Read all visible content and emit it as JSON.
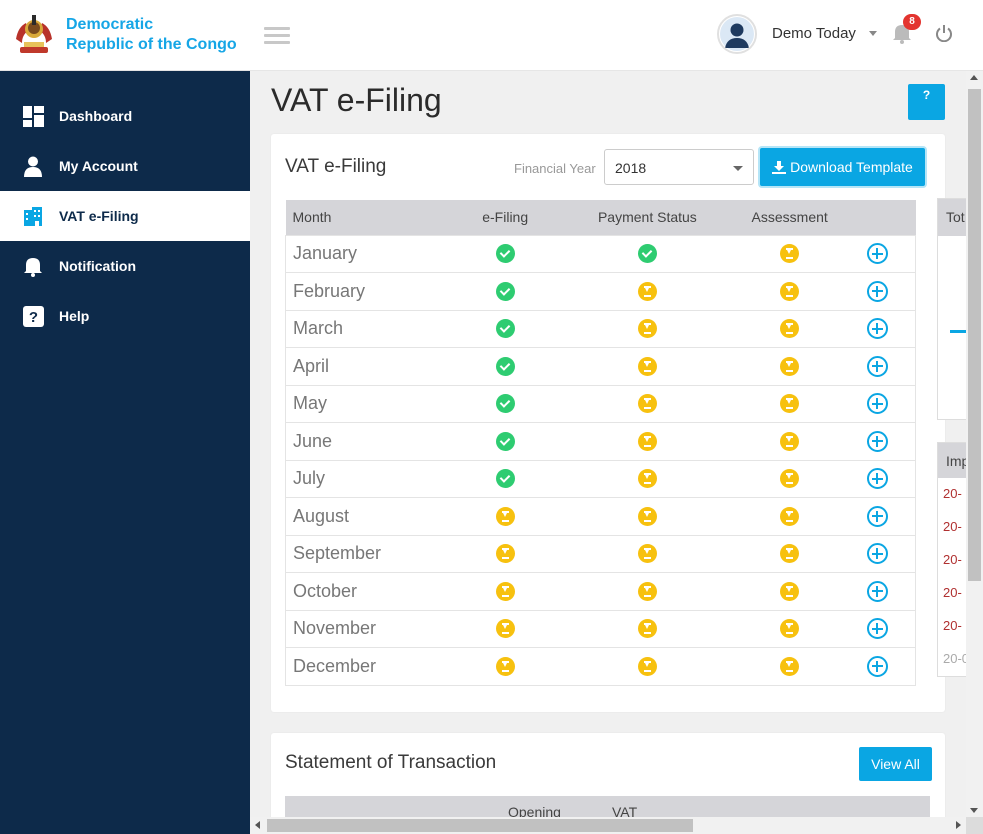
{
  "brand": {
    "line1": "Democratic",
    "line2": "Republic of the Congo"
  },
  "sidebar": {
    "items": [
      {
        "label": "Dashboard",
        "icon": "dashboard-icon"
      },
      {
        "label": "My Account",
        "icon": "user-icon"
      },
      {
        "label": "VAT e-Filing",
        "icon": "building-icon",
        "active": true
      },
      {
        "label": "Notification",
        "icon": "bell-icon"
      },
      {
        "label": "Help",
        "icon": "question-icon"
      }
    ]
  },
  "topbar": {
    "user_name": "Demo Today",
    "notification_count": "8"
  },
  "page": {
    "title": "VAT e-Filing",
    "help_label": "?"
  },
  "filing": {
    "title": "VAT e-Filing",
    "fy_label": "Financial Year",
    "fy_value": "2018",
    "download_label": "Download Template",
    "columns": [
      "Month",
      "e-Filing",
      "Payment Status",
      "Assessment"
    ],
    "rows": [
      {
        "month": "January",
        "efiling": "done",
        "payment": "done",
        "assessment": "pending"
      },
      {
        "month": "February",
        "efiling": "done",
        "payment": "pending",
        "assessment": "pending"
      },
      {
        "month": "March",
        "efiling": "done",
        "payment": "pending",
        "assessment": "pending"
      },
      {
        "month": "April",
        "efiling": "done",
        "payment": "pending",
        "assessment": "pending"
      },
      {
        "month": "May",
        "efiling": "done",
        "payment": "pending",
        "assessment": "pending"
      },
      {
        "month": "June",
        "efiling": "done",
        "payment": "pending",
        "assessment": "pending"
      },
      {
        "month": "July",
        "efiling": "done",
        "payment": "pending",
        "assessment": "pending"
      },
      {
        "month": "August",
        "efiling": "pending",
        "payment": "pending",
        "assessment": "pending"
      },
      {
        "month": "September",
        "efiling": "pending",
        "payment": "pending",
        "assessment": "pending"
      },
      {
        "month": "October",
        "efiling": "pending",
        "payment": "pending",
        "assessment": "pending"
      },
      {
        "month": "November",
        "efiling": "pending",
        "payment": "pending",
        "assessment": "pending"
      },
      {
        "month": "December",
        "efiling": "pending",
        "payment": "pending",
        "assessment": "pending"
      }
    ]
  },
  "statement": {
    "title": "Statement of Transaction",
    "view_all": "View All",
    "columns": [
      "Opening",
      "VAT"
    ]
  },
  "side_panels": {
    "panel1_header": "Tot",
    "panel2_header": "Imp",
    "panel2_rows": [
      "20-",
      "20-",
      "20-",
      "20-",
      "20-",
      "20-0"
    ]
  },
  "colors": {
    "sidebar": "#0d2a4a",
    "accent": "#0aa6e3",
    "success": "#2ecc71",
    "pending": "#f7c10f",
    "badge": "#e3342f"
  }
}
